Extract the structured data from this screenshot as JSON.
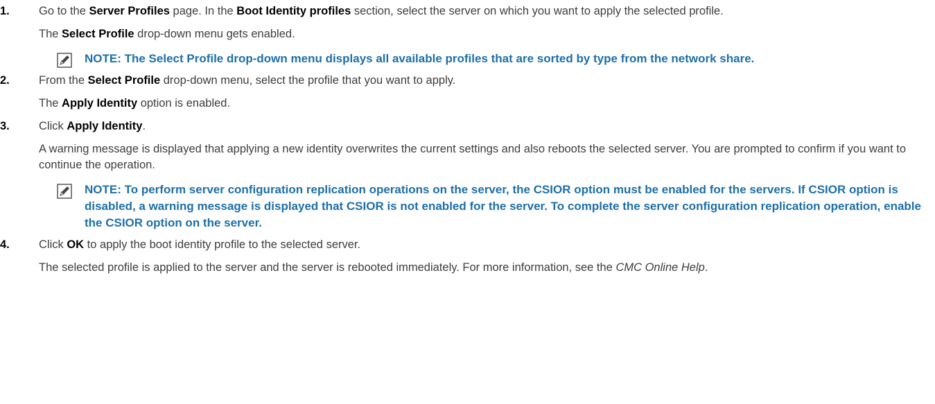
{
  "steps": [
    {
      "num": "1.",
      "p1": {
        "a": "Go to the ",
        "b1": "Server Profiles",
        "c": " page. In the ",
        "b2": "Boot Identity profiles",
        "d": " section, select the server on which you want to apply the selected profile."
      },
      "p2": {
        "a": "The ",
        "b1": "Select Profile",
        "c": " drop-down menu gets enabled."
      },
      "note": "NOTE: The Select Profile drop-down menu displays all available profiles that are sorted by type from the network share."
    },
    {
      "num": "2.",
      "p1": {
        "a": "From the ",
        "b1": "Select Profile",
        "c": " drop-down menu, select the profile that you want to apply."
      },
      "p2": {
        "a": "The ",
        "b1": "Apply Identity",
        "c": " option is enabled."
      }
    },
    {
      "num": "3.",
      "p1": {
        "a": "Click ",
        "b1": "Apply Identity",
        "c": "."
      },
      "p2": {
        "a": "A warning message is displayed that applying a new identity overwrites the current settings and also reboots the selected server. You are prompted to confirm if you want to continue the operation."
      },
      "note": "NOTE: To perform server configuration replication operations on the server, the CSIOR option must be enabled for the servers. If CSIOR option is disabled, a warning message is displayed that CSIOR is not enabled for the server. To complete the server configuration replication operation, enable the CSIOR option on the server."
    },
    {
      "num": "4.",
      "p1": {
        "a": "Click ",
        "b1": "OK",
        "c": " to apply the boot identity profile to the selected server."
      },
      "p2": {
        "a": "The selected profile is applied to the server and the server is rebooted immediately. For more information, see the ",
        "i1": "CMC Online Help",
        "c": "."
      }
    }
  ],
  "colors": {
    "note": "#1d6fa8",
    "text": "#3d3d3d"
  },
  "icons": {
    "note": "note-pencil-icon"
  }
}
